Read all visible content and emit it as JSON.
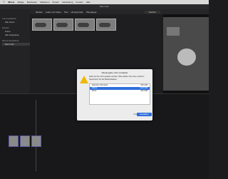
{
  "menubar": {
    "apple": "",
    "items": [
      "iMovie",
      "Ablage",
      "Bearbeiten",
      "Markieren",
      "Ändern",
      "Darstellung",
      "Fenster",
      "Hilfe"
    ],
    "right": ""
  },
  "window": {
    "title": "Mein Film"
  },
  "toolbar": {
    "media_label": "Medien",
    "audio_label": "Audio und Video",
    "titles_label": "Titel",
    "bg_label": "Hintergründe",
    "transitions_label": "Übergänge",
    "search_placeholder": "Suchen"
  },
  "sidebar": {
    "groups": [
      {
        "label": "Fotomediathek",
        "items": [
          "Alle Fotos"
        ]
      },
      {
        "label": "Medien",
        "items": [
          "Fotos",
          "Alle Ereignisse"
        ]
      },
      {
        "label": "iMovie-Mediathek",
        "items": [
          "Mein Film"
        ]
      }
    ],
    "selected": "Mein Film"
  },
  "dialog": {
    "title": "Wiedergabe nicht verfügbar",
    "message": "Datei konnte nicht geladen werden. Bitte wählen Sie einen anderen Speicherort für die Mediendateien.",
    "rows": [
      {
        "name": "Speicher-Übersicht",
        "size": "28,6 GB"
      },
      {
        "name": "iMovie",
        "size": "112,8 GB"
      },
      {
        "name": "Filme",
        "size": "45,3 GB"
      }
    ],
    "selected_index": 1,
    "cancel": "Abbrechen",
    "choose": "Auswählen"
  }
}
